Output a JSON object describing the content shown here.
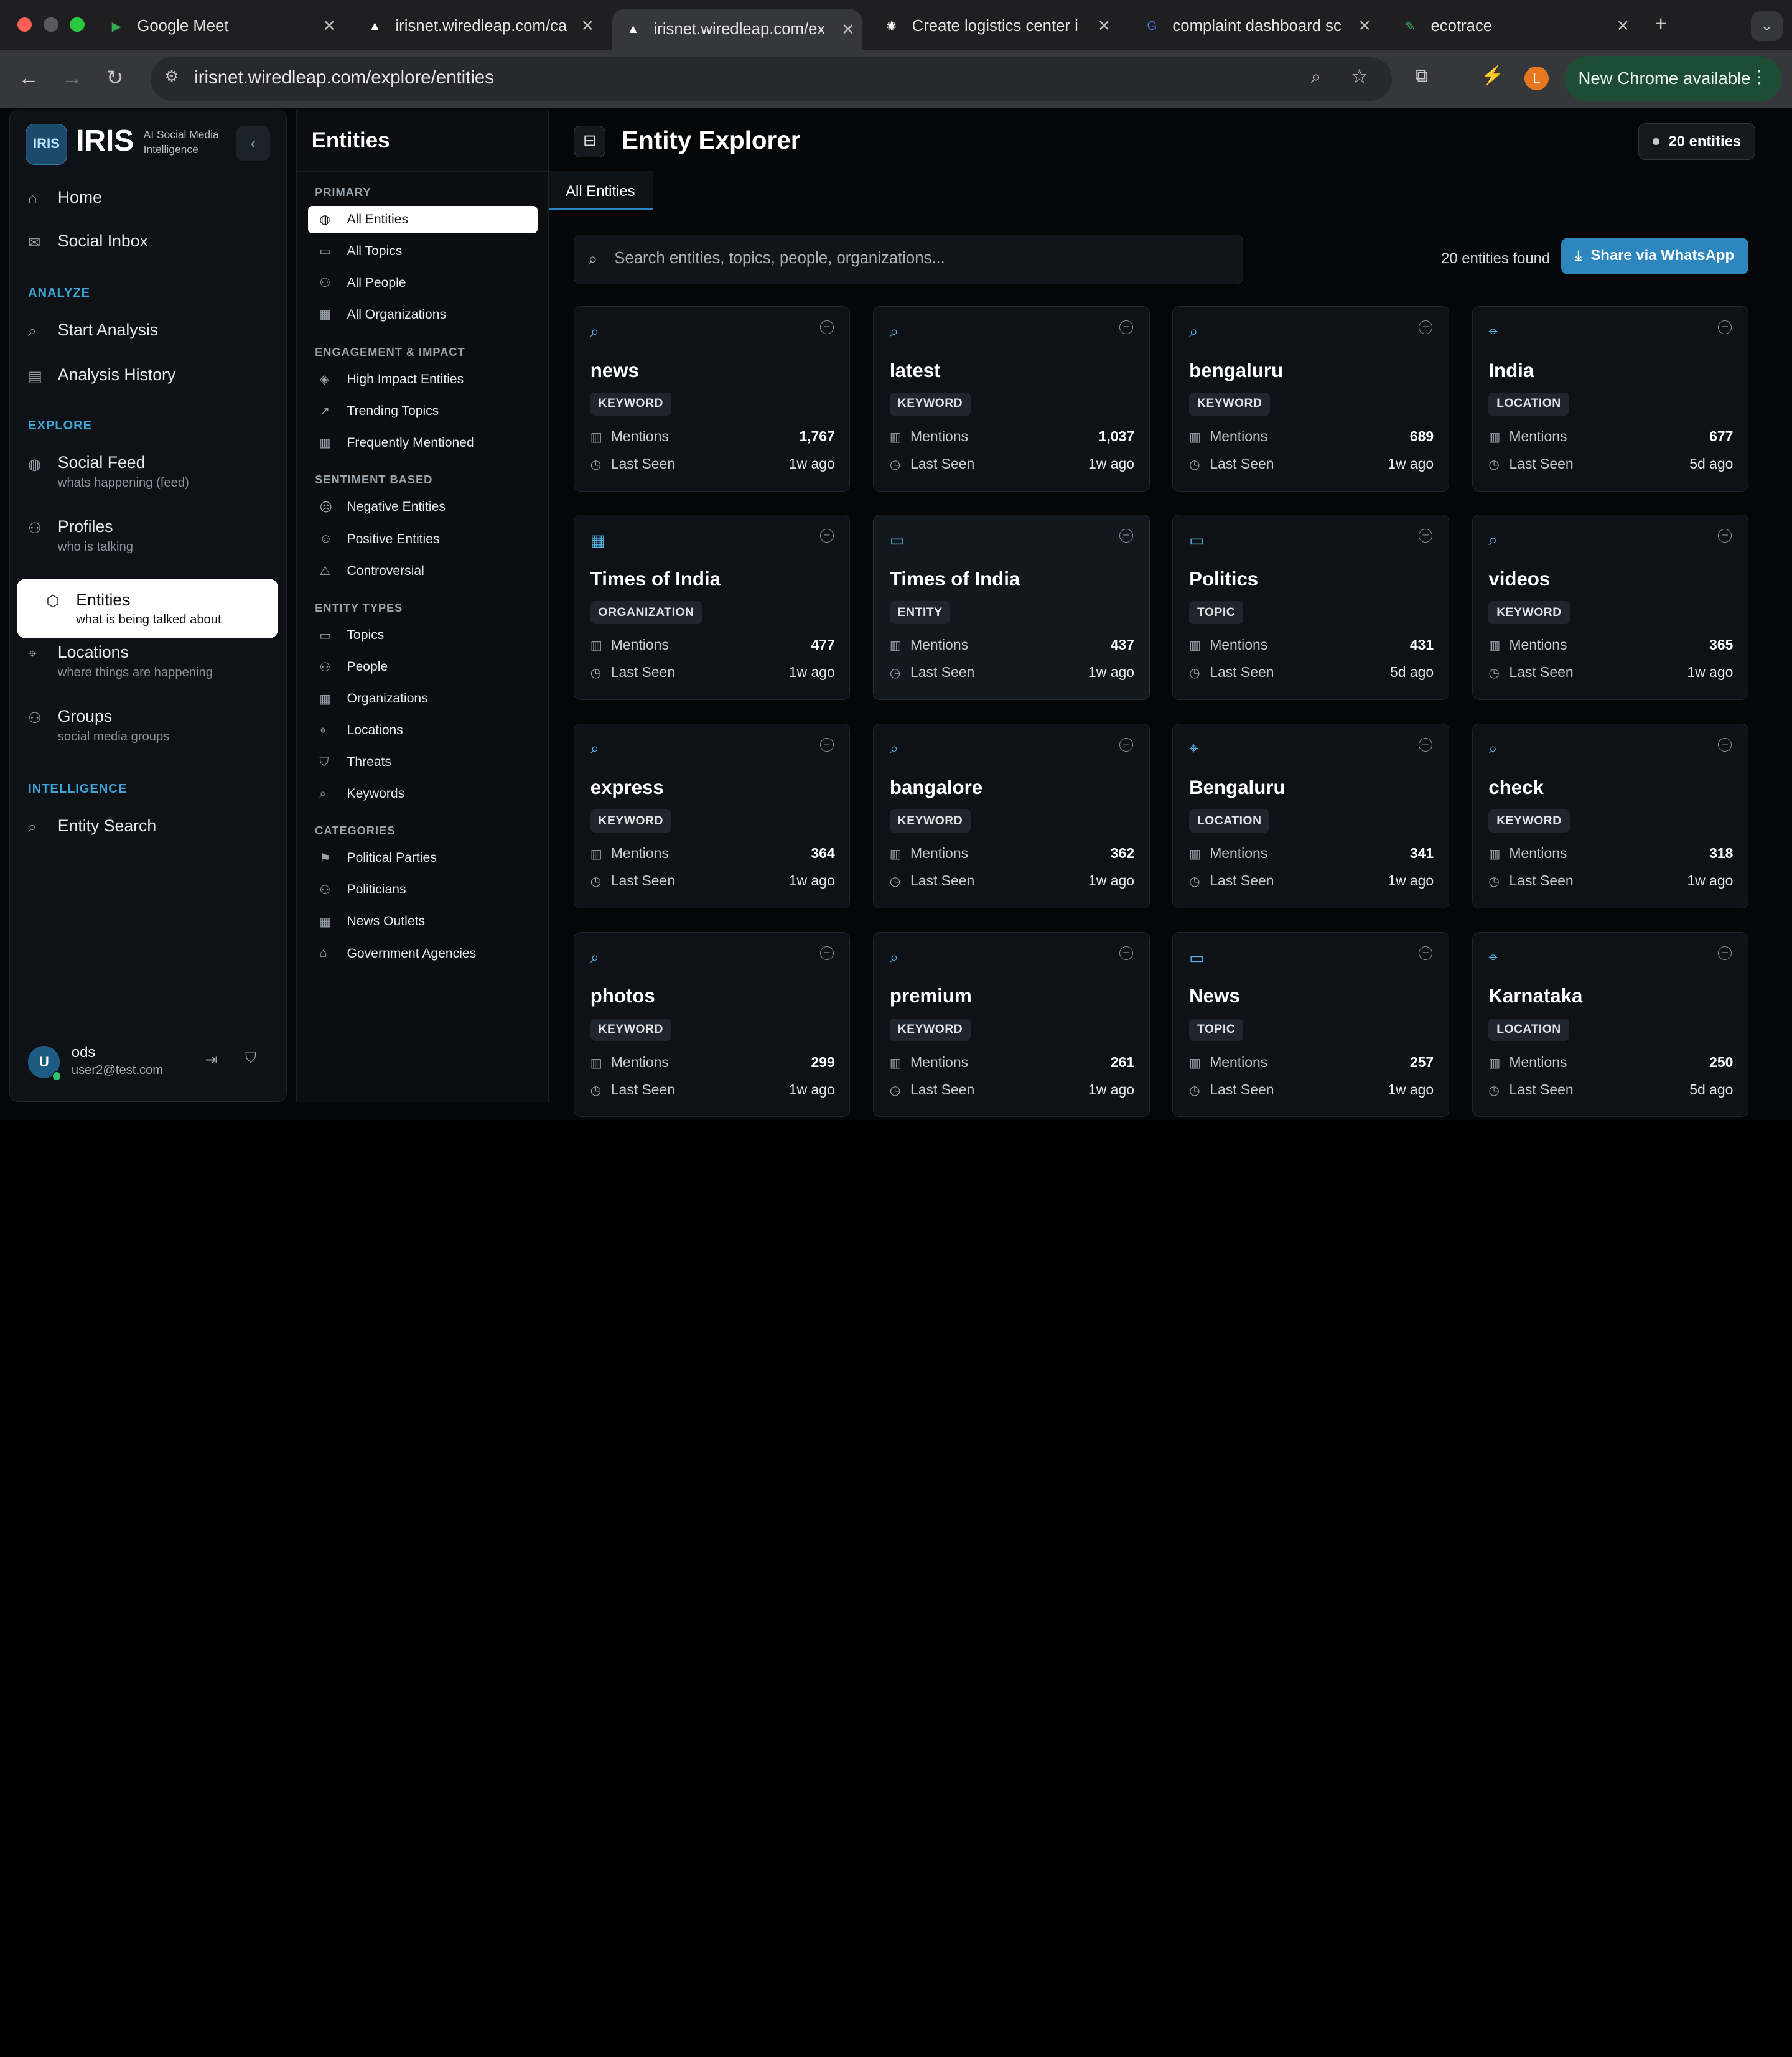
{
  "browser": {
    "tabs": [
      {
        "title": "Google Meet",
        "favicon": "meet"
      },
      {
        "title": "irisnet.wiredleap.com/ca",
        "favicon": "iris"
      },
      {
        "title": "irisnet.wiredleap.com/ex",
        "favicon": "iris"
      },
      {
        "title": "Create logistics center i",
        "favicon": "chatgpt"
      },
      {
        "title": "complaint dashboard sc",
        "favicon": "google"
      },
      {
        "title": "ecotrace",
        "favicon": "leaf"
      }
    ],
    "url": "irisnet.wiredleap.com/explore/entities",
    "profile_initial": "L",
    "update_label": "New Chrome available"
  },
  "sidebar": {
    "logo": "IRIS",
    "brand": "IRIS",
    "brand_sub": "AI Social Media Intelligence",
    "items_top": [
      {
        "label": "Home",
        "icon": "home-icon"
      },
      {
        "label": "Social Inbox",
        "icon": "inbox-icon"
      }
    ],
    "sections": {
      "analyze": "ANALYZE",
      "explore": "EXPLORE",
      "intelligence": "INTELLIGENCE"
    },
    "analyze_items": [
      {
        "label": "Start Analysis",
        "icon": "search-icon"
      },
      {
        "label": "Analysis History",
        "icon": "document-icon"
      }
    ],
    "explore_items": [
      {
        "label": "Social Feed",
        "sub": "whats happening (feed)",
        "icon": "globe-icon"
      },
      {
        "label": "Profiles",
        "sub": "who is talking",
        "icon": "users-icon"
      },
      {
        "label": "Entities",
        "sub": "what is being talked about",
        "icon": "cube-icon"
      },
      {
        "label": "Locations",
        "sub": "where things are happening",
        "icon": "pin-icon"
      },
      {
        "label": "Groups",
        "sub": "social media groups",
        "icon": "group-icon"
      }
    ],
    "intelligence_items": [
      {
        "label": "Entity Search",
        "icon": "search-icon"
      }
    ],
    "user": {
      "initial": "U",
      "name": "ods",
      "email": "user2@test.com"
    }
  },
  "panel": {
    "title": "Entities",
    "sections": {
      "primary": "PRIMARY",
      "engagement": "ENGAGEMENT & IMPACT",
      "sentiment": "SENTIMENT BASED",
      "types": "ENTITY TYPES",
      "categories": "CATEGORIES"
    },
    "primary": [
      "All Entities",
      "All Topics",
      "All People",
      "All Organizations"
    ],
    "engagement": [
      "High Impact Entities",
      "Trending Topics",
      "Frequently Mentioned"
    ],
    "sentiment": [
      "Negative Entities",
      "Positive Entities",
      "Controversial"
    ],
    "types": [
      "Topics",
      "People",
      "Organizations",
      "Locations",
      "Threats",
      "Keywords"
    ],
    "categories": [
      "Political Parties",
      "Politicians",
      "News Outlets",
      "Government Agencies"
    ]
  },
  "main": {
    "title": "Entity Explorer",
    "count_badge": "20 entities",
    "tab": "All Entities",
    "search_placeholder": "Search entities, topics, people, organizations...",
    "found": "20 entities found",
    "share_label": "Share via WhatsApp",
    "mentions_label": "Mentions",
    "last_seen_label": "Last Seen",
    "colors": {
      "accent": "#2d87be",
      "icon": "#57b6e8"
    },
    "cards": [
      {
        "name": "news",
        "type": "KEYWORD",
        "icon": "search-icon",
        "mentions": "1,767",
        "last_seen": "1w ago"
      },
      {
        "name": "latest",
        "type": "KEYWORD",
        "icon": "search-icon",
        "mentions": "1,037",
        "last_seen": "1w ago"
      },
      {
        "name": "bengaluru",
        "type": "KEYWORD",
        "icon": "search-icon",
        "mentions": "689",
        "last_seen": "1w ago"
      },
      {
        "name": "India",
        "type": "LOCATION",
        "icon": "pin-icon",
        "mentions": "677",
        "last_seen": "5d ago"
      },
      {
        "name": "Times of India",
        "type": "ORGANIZATION",
        "icon": "building-icon",
        "mentions": "477",
        "last_seen": "1w ago"
      },
      {
        "name": "Times of India",
        "type": "ENTITY",
        "icon": "chat-icon",
        "mentions": "437",
        "last_seen": "1w ago"
      },
      {
        "name": "Politics",
        "type": "TOPIC",
        "icon": "chat-icon",
        "mentions": "431",
        "last_seen": "5d ago"
      },
      {
        "name": "videos",
        "type": "KEYWORD",
        "icon": "search-icon",
        "mentions": "365",
        "last_seen": "1w ago"
      },
      {
        "name": "express",
        "type": "KEYWORD",
        "icon": "search-icon",
        "mentions": "364",
        "last_seen": "1w ago"
      },
      {
        "name": "bangalore",
        "type": "KEYWORD",
        "icon": "search-icon",
        "mentions": "362",
        "last_seen": "1w ago"
      },
      {
        "name": "Bengaluru",
        "type": "LOCATION",
        "icon": "pin-icon",
        "mentions": "341",
        "last_seen": "1w ago"
      },
      {
        "name": "check",
        "type": "KEYWORD",
        "icon": "search-icon",
        "mentions": "318",
        "last_seen": "1w ago"
      },
      {
        "name": "photos",
        "type": "KEYWORD",
        "icon": "search-icon",
        "mentions": "299",
        "last_seen": "1w ago"
      },
      {
        "name": "premium",
        "type": "KEYWORD",
        "icon": "search-icon",
        "mentions": "261",
        "last_seen": "1w ago"
      },
      {
        "name": "News",
        "type": "TOPIC",
        "icon": "chat-icon",
        "mentions": "257",
        "last_seen": "1w ago"
      },
      {
        "name": "Karnataka",
        "type": "LOCATION",
        "icon": "pin-icon",
        "mentions": "250",
        "last_seen": "5d ago"
      }
    ]
  }
}
